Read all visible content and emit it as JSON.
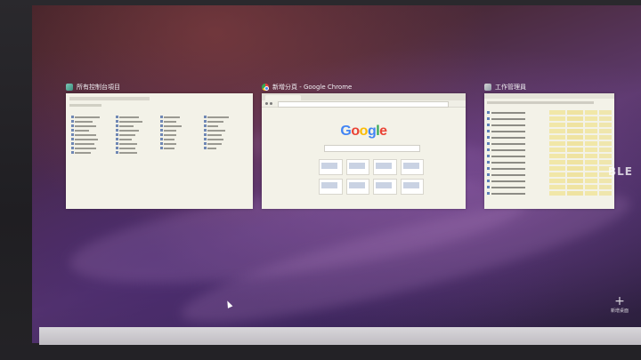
{
  "task_view": {
    "windows": [
      {
        "title": "所有控制台項目",
        "icon": "control-panel-icon"
      },
      {
        "title": "新增分頁 - Google Chrome",
        "icon": "chrome-icon"
      },
      {
        "title": "工作管理員",
        "icon": "task-manager-icon"
      }
    ],
    "chrome_page": {
      "logo": "Google"
    },
    "new_desktop": {
      "symbol": "+",
      "label": "新增桌面"
    },
    "edge_text": "BLE"
  }
}
